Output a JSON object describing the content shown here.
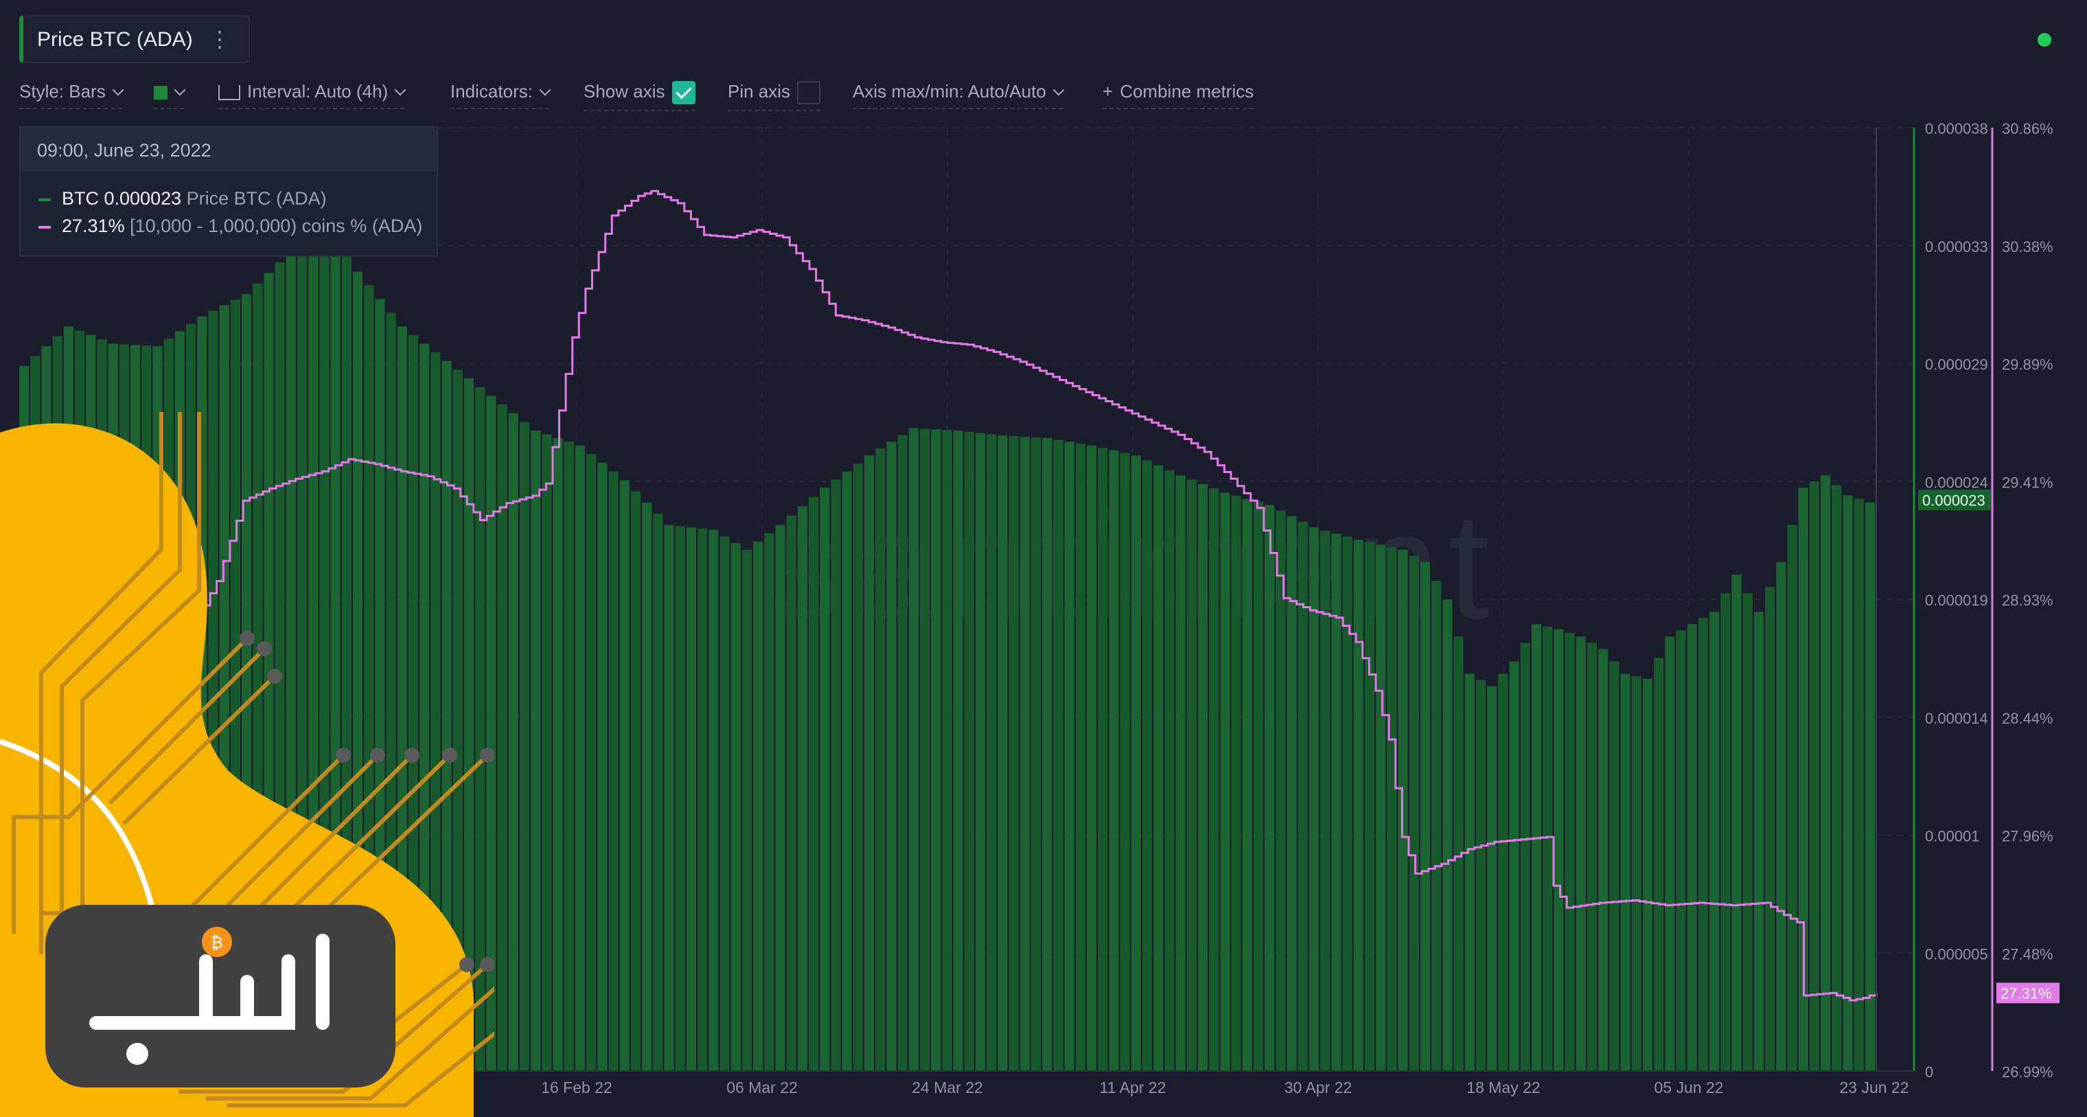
{
  "header": {
    "title": "Price BTC (ADA)"
  },
  "toolbar": {
    "style": "Style: Bars",
    "interval": "Interval: Auto (4h)",
    "indicators": "Indicators:",
    "show_axis": "Show axis",
    "pin_axis": "Pin axis",
    "axis_maxmin": "Axis max/min: Auto/Auto",
    "combine": "Combine metrics"
  },
  "tooltip": {
    "date": "09:00, June 23, 2022",
    "series1_value": "BTC 0.000023",
    "series1_label": "Price BTC (ADA)",
    "series2_value": "27.31%",
    "series2_label": "[10,000 - 1,000,000) coins % (ADA)"
  },
  "watermark": "santiment",
  "colors": {
    "bars": "#1a5c2f",
    "bars_top": "#1f7a3a",
    "line": "#e27be8",
    "background": "#1b1d2c",
    "accent_green": "#26c957"
  },
  "chart_data": {
    "type": "bar",
    "x_labels": [
      "16 Feb 22",
      "06 Mar 22",
      "24 Mar 22",
      "11 Apr 22",
      "30 Apr 22",
      "18 May 22",
      "05 Jun 22",
      "23 Jun 22"
    ],
    "y_left": {
      "ticks": [
        "0.000038",
        "0.000033",
        "0.000029",
        "0.000024",
        "0.000019",
        "0.000014",
        "0.00001",
        "0.000005",
        "0"
      ],
      "current": "0.000023",
      "ylim": [
        0,
        3.8e-05
      ]
    },
    "y_right": {
      "ticks": [
        "30.86%",
        "30.38%",
        "29.89%",
        "29.41%",
        "28.93%",
        "28.44%",
        "27.96%",
        "27.48%",
        "26.99%"
      ],
      "current": "27.31%",
      "ylim": [
        26.99,
        30.86
      ]
    },
    "grid": true,
    "series": [
      {
        "name": "Price BTC (ADA)",
        "type": "bar",
        "axis": "left",
        "points": [
          [
            0,
            2.84e-05
          ],
          [
            4,
            3e-05
          ],
          [
            8,
            2.93e-05
          ],
          [
            12,
            2.92e-05
          ],
          [
            16,
            3.04e-05
          ],
          [
            20,
            3.13e-05
          ],
          [
            24,
            3.3e-05
          ],
          [
            27,
            3.41e-05
          ],
          [
            30,
            3.22e-05
          ],
          [
            34,
            3e-05
          ],
          [
            38,
            2.86e-05
          ],
          [
            42,
            2.72e-05
          ],
          [
            46,
            2.58e-05
          ],
          [
            50,
            2.52e-05
          ],
          [
            54,
            2.38e-05
          ],
          [
            58,
            2.2e-05
          ],
          [
            62,
            2.18e-05
          ],
          [
            65,
            2.1e-05
          ],
          [
            68,
            2.2e-05
          ],
          [
            72,
            2.35e-05
          ],
          [
            76,
            2.48e-05
          ],
          [
            80,
            2.59e-05
          ],
          [
            84,
            2.58e-05
          ],
          [
            88,
            2.56e-05
          ],
          [
            92,
            2.55e-05
          ],
          [
            96,
            2.52e-05
          ],
          [
            100,
            2.48e-05
          ],
          [
            104,
            2.4e-05
          ],
          [
            108,
            2.33e-05
          ],
          [
            112,
            2.28e-05
          ],
          [
            116,
            2.19e-05
          ],
          [
            120,
            2.14e-05
          ],
          [
            124,
            2.1e-05
          ],
          [
            126,
            2.05e-05
          ],
          [
            128,
            1.9e-05
          ],
          [
            130,
            1.6e-05
          ],
          [
            132,
            1.55e-05
          ],
          [
            134,
            1.65e-05
          ],
          [
            136,
            1.8e-05
          ],
          [
            138,
            1.78e-05
          ],
          [
            140,
            1.75e-05
          ],
          [
            142,
            1.7e-05
          ],
          [
            144,
            1.6e-05
          ],
          [
            146,
            1.58e-05
          ],
          [
            148,
            1.75e-05
          ],
          [
            150,
            1.8e-05
          ],
          [
            152,
            1.85e-05
          ],
          [
            154,
            2e-05
          ],
          [
            156,
            1.85e-05
          ],
          [
            158,
            2.05e-05
          ],
          [
            160,
            2.35e-05
          ],
          [
            162,
            2.4e-05
          ],
          [
            164,
            2.32e-05
          ],
          [
            166,
            2.29e-05
          ]
        ]
      },
      {
        "name": "[10,000 - 1,000,000) coins % (ADA)",
        "type": "line",
        "axis": "right",
        "points": [
          [
            0,
            28.6
          ],
          [
            8,
            28.61
          ],
          [
            14,
            28.62
          ],
          [
            19,
            28.65
          ],
          [
            20,
            28.68
          ],
          [
            21,
            28.8
          ],
          [
            22,
            28.78
          ],
          [
            26,
            28.8
          ],
          [
            28,
            28.9
          ],
          [
            30,
            29.0
          ],
          [
            34,
            29.33
          ],
          [
            38,
            29.38
          ],
          [
            42,
            29.42
          ],
          [
            46,
            29.45
          ],
          [
            50,
            29.5
          ],
          [
            54,
            29.48
          ],
          [
            58,
            29.45
          ],
          [
            62,
            29.43
          ],
          [
            66,
            29.38
          ],
          [
            70,
            29.25
          ],
          [
            74,
            29.32
          ],
          [
            78,
            29.35
          ],
          [
            80,
            29.4
          ],
          [
            82,
            29.7
          ],
          [
            84,
            30.0
          ],
          [
            86,
            30.2
          ],
          [
            90,
            30.5
          ],
          [
            94,
            30.58
          ],
          [
            96,
            30.6
          ],
          [
            100,
            30.55
          ],
          [
            104,
            30.42
          ],
          [
            108,
            30.41
          ],
          [
            112,
            30.44
          ],
          [
            116,
            30.41
          ],
          [
            120,
            30.28
          ],
          [
            124,
            30.09
          ],
          [
            128,
            30.07
          ],
          [
            132,
            30.04
          ],
          [
            136,
            30.0
          ],
          [
            140,
            29.98
          ],
          [
            144,
            29.97
          ],
          [
            148,
            29.94
          ],
          [
            152,
            29.9
          ],
          [
            156,
            29.85
          ],
          [
            160,
            29.8
          ],
          [
            164,
            29.75
          ],
          [
            168,
            29.7
          ],
          [
            172,
            29.65
          ],
          [
            176,
            29.6
          ],
          [
            180,
            29.53
          ],
          [
            184,
            29.42
          ],
          [
            188,
            29.3
          ],
          [
            192,
            28.93
          ],
          [
            196,
            28.88
          ],
          [
            200,
            28.85
          ],
          [
            203,
            28.75
          ],
          [
            206,
            28.55
          ],
          [
            208,
            28.35
          ],
          [
            210,
            27.95
          ],
          [
            212,
            27.8
          ],
          [
            216,
            27.84
          ],
          [
            220,
            27.9
          ],
          [
            224,
            27.93
          ],
          [
            228,
            27.94
          ],
          [
            232,
            27.95
          ],
          [
            233,
            27.75
          ],
          [
            235,
            27.66
          ],
          [
            240,
            27.68
          ],
          [
            245,
            27.69
          ],
          [
            250,
            27.67
          ],
          [
            255,
            27.68
          ],
          [
            260,
            27.67
          ],
          [
            265,
            27.68
          ],
          [
            268,
            27.63
          ],
          [
            270,
            27.6
          ],
          [
            271,
            27.3
          ],
          [
            275,
            27.31
          ],
          [
            278,
            27.28
          ],
          [
            280,
            27.29
          ],
          [
            282,
            27.31
          ]
        ]
      }
    ]
  }
}
